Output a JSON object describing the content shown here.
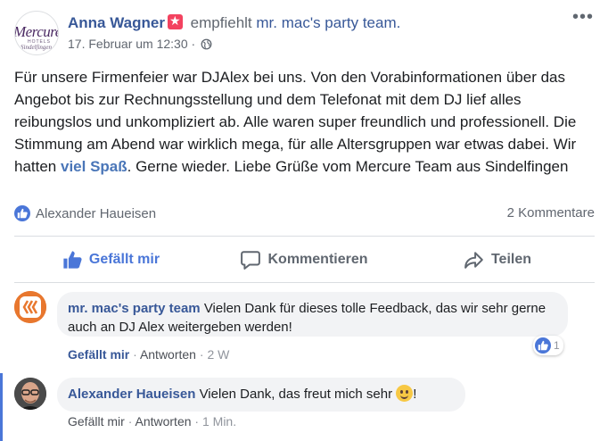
{
  "post": {
    "author": "Anna Wagner",
    "recommends_text": "empfiehlt",
    "page_name": "mr. mac's party team.",
    "date": "17. Februar um 12:30",
    "date_separator": "·",
    "more_label": "•••",
    "avatar_logo": {
      "line1": "Mercure",
      "line2": "HOTELS",
      "line3": "Sindelfingen"
    },
    "body_part1": "Für unsere Firmenfeier war DJAlex bei uns. Von den Vorabinformationen über das Angebot bis zur Rechnungsstellung und dem Telefonat mit dem DJ lief alles reibungslos und unkompliziert ab. Alle waren super freundlich und professionell. Die Stimmung am Abend war wirklich mega, für alle Altersgruppen war etwas dabei. Wir hatten ",
    "body_highlight": "viel Spaß",
    "body_part2": ". Gerne wieder. Liebe Grüße vom Mercure Team aus Sindelfingen"
  },
  "stats": {
    "likers": "Alexander Haueisen",
    "comment_count": "2 Kommentare"
  },
  "actions": {
    "like": "Gefällt mir",
    "comment": "Kommentieren",
    "share": "Teilen"
  },
  "comments": [
    {
      "author": "mr. mac's party team",
      "text": "Vielen Dank für dieses tolle Feedback, das wir sehr gerne auch an DJ Alex weitergeben werden!",
      "like_label": "Gefällt mir",
      "reply_label": "Antworten",
      "sep": "·",
      "time": "2 W",
      "reaction_count": "1"
    },
    {
      "author": "Alexander Haueisen",
      "text": "Vielen Dank, das freut mich sehr",
      "suffix": "!",
      "like_label": "Gefällt mir",
      "reply_label": "Antworten",
      "sep": "·",
      "time": "1 Min."
    }
  ],
  "colors": {
    "link_blue": "#385898",
    "like_blue": "#4a76d8",
    "recommend_red": "#f3425f",
    "bubble_bg": "#f2f3f5",
    "mac_orange": "#e8772e"
  }
}
